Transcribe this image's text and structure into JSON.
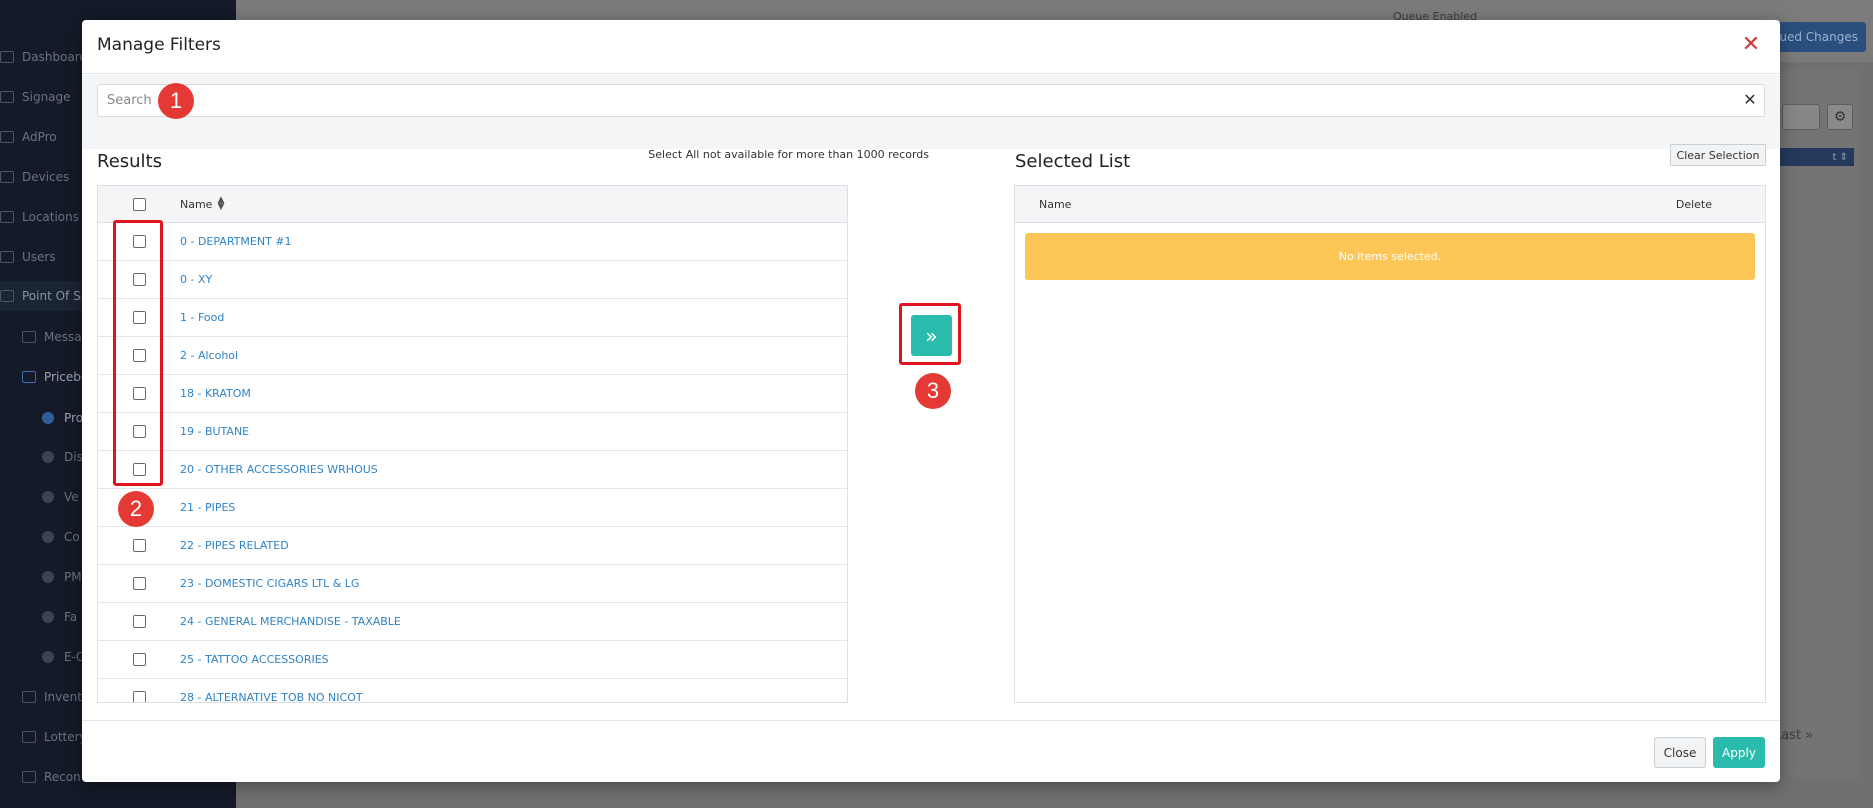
{
  "background": {
    "sidebar": [
      {
        "label": "Dashboard"
      },
      {
        "label": "Signage"
      },
      {
        "label": "AdPro"
      },
      {
        "label": "Devices"
      },
      {
        "label": "Locations"
      },
      {
        "label": "Users"
      },
      {
        "label": "Point Of Sa"
      },
      {
        "label": "Messa"
      },
      {
        "label": "Pricebo"
      },
      {
        "label": "Pro"
      },
      {
        "label": "Dis"
      },
      {
        "label": "Ve"
      },
      {
        "label": "Co"
      },
      {
        "label": "PM"
      },
      {
        "label": "Fa"
      },
      {
        "label": "E-C"
      },
      {
        "label": "Invent"
      },
      {
        "label": "Lottery"
      },
      {
        "label": "Recon"
      }
    ],
    "queue_label": "Queue Enabled",
    "queued_changes_label": "ued Changes",
    "table_header_sort": "t ⇕",
    "pagination_last": "Last »"
  },
  "modal": {
    "title": "Manage Filters",
    "search": {
      "placeholder": "Search",
      "value": ""
    },
    "results": {
      "title": "Results",
      "note": "Select All not available for more than 1000 records",
      "name_header": "Name",
      "rows": [
        {
          "name": "0 - DEPARTMENT #1"
        },
        {
          "name": "0 - XY"
        },
        {
          "name": "1 - Food"
        },
        {
          "name": "2 - Alcohol"
        },
        {
          "name": "18 - KRATOM"
        },
        {
          "name": "19 - BUTANE"
        },
        {
          "name": "20 - OTHER ACCESSORIES WRHOUS"
        },
        {
          "name": "21 - PIPES"
        },
        {
          "name": "22 - PIPES RELATED"
        },
        {
          "name": "23 - DOMESTIC CIGARS LTL & LG"
        },
        {
          "name": "24 - GENERAL MERCHANDISE - TAXABLE"
        },
        {
          "name": "25 - TATTOO ACCESSORIES"
        },
        {
          "name": "28 - ALTERNATIVE TOB NO NICOT"
        }
      ]
    },
    "transfer_button_icon": "»",
    "selected": {
      "title": "Selected List",
      "clear_label": "Clear Selection",
      "name_header": "Name",
      "delete_header": "Delete",
      "empty_message": "No items selected."
    },
    "footer": {
      "close_label": "Close",
      "apply_label": "Apply"
    }
  },
  "annotations": [
    {
      "number": "1"
    },
    {
      "number": "2"
    },
    {
      "number": "3"
    }
  ],
  "colors": {
    "accent_teal": "#2bbbad",
    "link_blue": "#2f83c5",
    "warning_yellow": "#fec656",
    "annotation_red": "#e53935"
  }
}
